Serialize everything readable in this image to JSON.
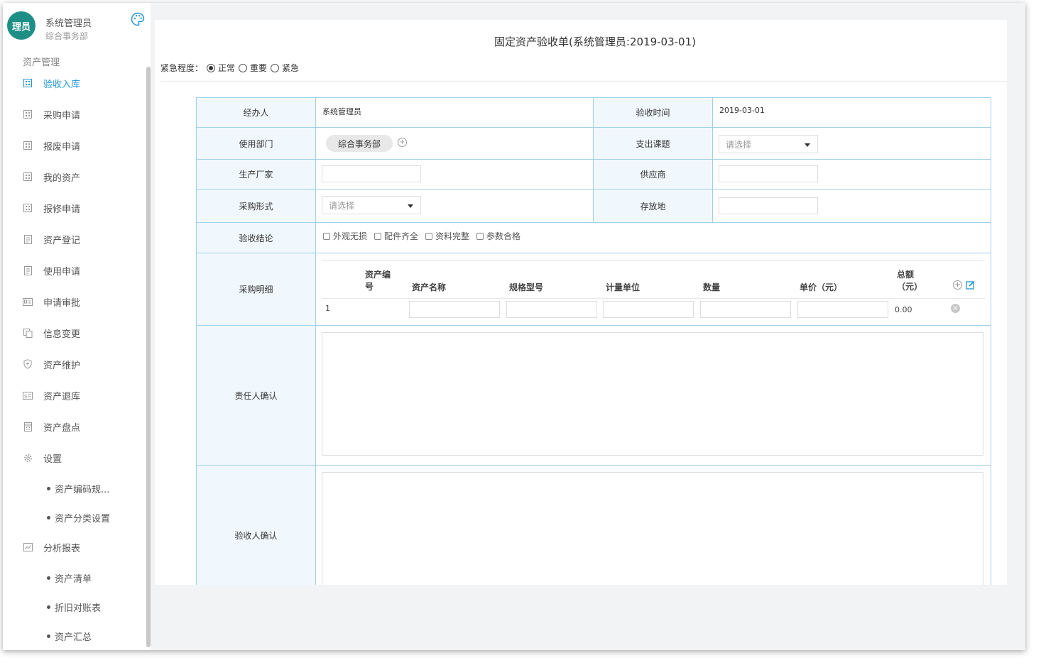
{
  "user": {
    "avatar_text": "理员",
    "name": "系统管理员",
    "dept": "综合事务部"
  },
  "sidebar": {
    "section": "资产管理",
    "items": [
      {
        "label": "验收入库",
        "icon": "grid-icon",
        "active": true
      },
      {
        "label": "采购申请",
        "icon": "grid-icon"
      },
      {
        "label": "报废申请",
        "icon": "grid-icon"
      },
      {
        "label": "我的资产",
        "icon": "grid-icon"
      },
      {
        "label": "报修申请",
        "icon": "grid-icon"
      },
      {
        "label": "资产登记",
        "icon": "document-icon"
      },
      {
        "label": "使用申请",
        "icon": "document-icon"
      },
      {
        "label": "申请审批",
        "icon": "id-card-icon"
      },
      {
        "label": "信息变更",
        "icon": "files-icon"
      },
      {
        "label": "资产维护",
        "icon": "shield-icon"
      },
      {
        "label": "资产退库",
        "icon": "return-icon"
      },
      {
        "label": "资产盘点",
        "icon": "calculator-icon"
      },
      {
        "label": "设置",
        "icon": "gear-icon"
      }
    ],
    "settings_sub": [
      "资产编码规...",
      "资产分类设置"
    ],
    "report": {
      "label": "分析报表",
      "icon": "chart-icon"
    },
    "report_sub": [
      "资产清单",
      "折旧对账表",
      "资产汇总"
    ]
  },
  "form": {
    "title": "固定资产验收单(系统管理员:2019-03-01)",
    "urgency": {
      "label": "紧急程度：",
      "options": [
        "正常",
        "重要",
        "紧急"
      ],
      "selected": "正常"
    },
    "handler_label": "经办人",
    "handler_value": "系统管理员",
    "accept_time_label": "验收时间",
    "accept_time_value": "2019-03-01",
    "dept_label": "使用部门",
    "dept_tag": "综合事务部",
    "expense_label": "支出课题",
    "select_placeholder": "请选择",
    "manufacturer_label": "生产厂家",
    "supplier_label": "供应商",
    "purchase_form_label": "采购形式",
    "storage_label": "存放地",
    "conclusion_label": "验收结论",
    "conclusion_options": [
      "外观无损",
      "配件齐全",
      "资料完整",
      "参数合格"
    ],
    "detail_label": "采购明细",
    "detail_columns": {
      "code_line1": "资产编",
      "code_line2": "号",
      "name": "资产名称",
      "spec": "规格型号",
      "unit": "计量单位",
      "qty": "数量",
      "price": "单价（元）",
      "total_line1": "总额",
      "total_line2": "（元）"
    },
    "detail_rows": [
      {
        "index": "1",
        "total": "0.00"
      }
    ],
    "responsible_label": "责任人确认",
    "acceptor_label": "验收人确认"
  },
  "colors": {
    "accent": "#2196d3",
    "avatar": "#1e8f86",
    "border": "#9fd0ea",
    "label_bg": "#f1f8fd"
  }
}
